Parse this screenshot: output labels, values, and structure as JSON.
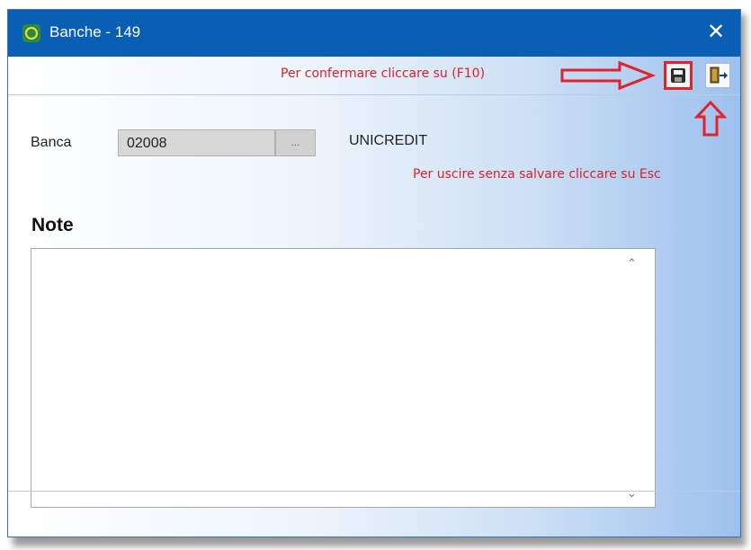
{
  "window": {
    "title": "Banche - 149",
    "close_glyph": "✕",
    "app_icon": "app-logo-icon"
  },
  "toolbar": {
    "confirm_hint": "Per confermare cliccare su (F10)",
    "save_icon": "floppy-disk-icon",
    "exit_icon": "exit-door-icon"
  },
  "form": {
    "bank_label": "Banca",
    "bank_code": "02008",
    "lookup_label": "...",
    "bank_name": "UNICREDIT",
    "escape_hint": "Per uscire senza salvare cliccare su Esc",
    "note_label": "Note",
    "note_value": ""
  },
  "colors": {
    "titlebar": "#0a5fb4",
    "annotation": "#d9222a"
  }
}
